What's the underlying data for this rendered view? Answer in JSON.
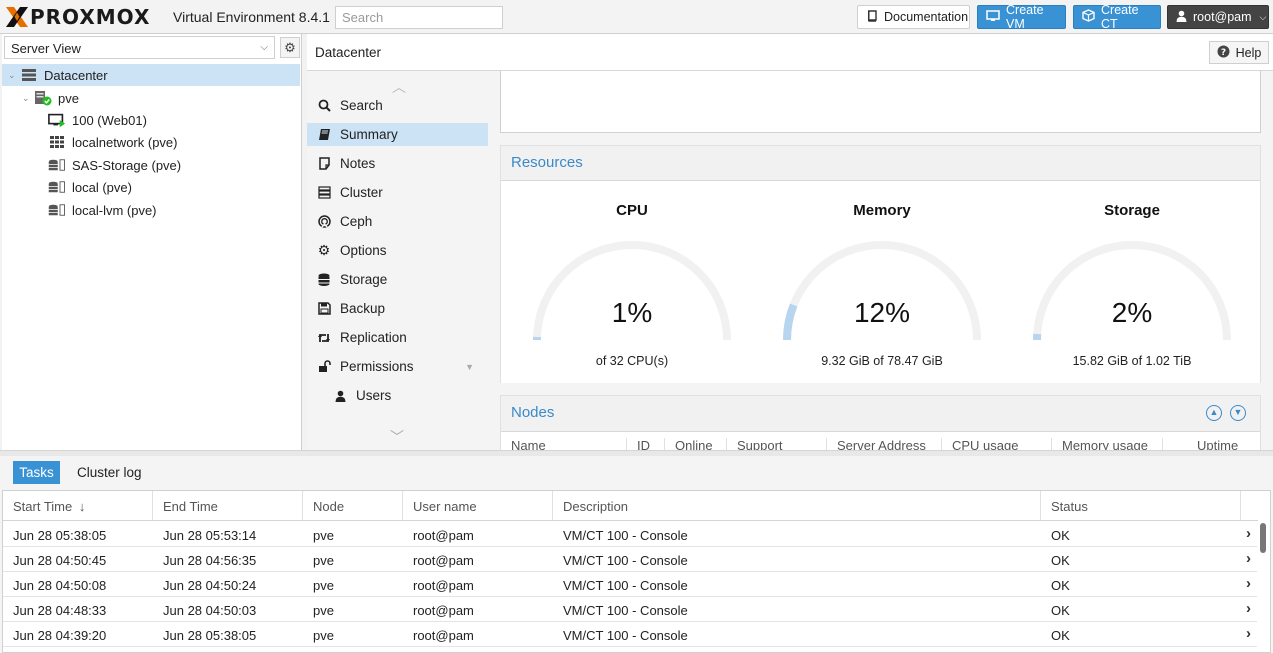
{
  "app": {
    "logo_text": "PROXMOX",
    "version": "Virtual Environment 8.4.1",
    "search_placeholder": "Search"
  },
  "toolbar": {
    "documentation": "Documentation",
    "create_vm": "Create VM",
    "create_ct": "Create CT",
    "user": "root@pam"
  },
  "tree": {
    "view": "Server View",
    "items": [
      {
        "label": "Datacenter"
      },
      {
        "label": "pve"
      },
      {
        "label": "100 (Web01)"
      },
      {
        "label": "localnetwork (pve)"
      },
      {
        "label": "SAS-Storage (pve)"
      },
      {
        "label": "local (pve)"
      },
      {
        "label": "local-lvm (pve)"
      }
    ]
  },
  "header": {
    "title": "Datacenter",
    "help": "Help"
  },
  "menu": {
    "items": [
      {
        "label": "Search",
        "icon": "search-icon"
      },
      {
        "label": "Summary",
        "icon": "book-icon"
      },
      {
        "label": "Notes",
        "icon": "notes-icon"
      },
      {
        "label": "Cluster",
        "icon": "server-icon"
      },
      {
        "label": "Ceph",
        "icon": "ceph-icon"
      },
      {
        "label": "Options",
        "icon": "gear-icon"
      },
      {
        "label": "Storage",
        "icon": "database-icon"
      },
      {
        "label": "Backup",
        "icon": "floppy-icon"
      },
      {
        "label": "Replication",
        "icon": "retweet-icon"
      },
      {
        "label": "Permissions",
        "icon": "unlock-icon"
      },
      {
        "label": "Users",
        "icon": "user-icon"
      }
    ]
  },
  "resources": {
    "title": "Resources",
    "gauges": [
      {
        "title": "CPU",
        "value": "1%",
        "fraction": 0.01,
        "sub": "of 32 CPU(s)"
      },
      {
        "title": "Memory",
        "value": "12%",
        "fraction": 0.12,
        "sub": "9.32 GiB of 78.47 GiB"
      },
      {
        "title": "Storage",
        "value": "2%",
        "fraction": 0.02,
        "sub": "15.82 GiB of 1.02 TiB"
      }
    ],
    "gauge_track_color": "#f1f1f1",
    "gauge_fill_color": "#b7d5ee"
  },
  "nodes": {
    "title": "Nodes",
    "columns": [
      "Name",
      "ID",
      "Online",
      "Support",
      "Server Address",
      "CPU usage",
      "Memory usage",
      "Uptime"
    ]
  },
  "tasks": {
    "tabs": [
      "Tasks",
      "Cluster log"
    ],
    "columns": [
      "Start Time",
      "End Time",
      "Node",
      "User name",
      "Description",
      "Status"
    ],
    "sort_indicator": "↓",
    "rows": [
      {
        "start": "Jun 28 05:38:05",
        "end": "Jun 28 05:53:14",
        "node": "pve",
        "user": "root@pam",
        "desc": "VM/CT 100 - Console",
        "status": "OK"
      },
      {
        "start": "Jun 28 04:50:45",
        "end": "Jun 28 04:56:35",
        "node": "pve",
        "user": "root@pam",
        "desc": "VM/CT 100 - Console",
        "status": "OK"
      },
      {
        "start": "Jun 28 04:50:08",
        "end": "Jun 28 04:50:24",
        "node": "pve",
        "user": "root@pam",
        "desc": "VM/CT 100 - Console",
        "status": "OK"
      },
      {
        "start": "Jun 28 04:48:33",
        "end": "Jun 28 04:50:03",
        "node": "pve",
        "user": "root@pam",
        "desc": "VM/CT 100 - Console",
        "status": "OK"
      },
      {
        "start": "Jun 28 04:39:20",
        "end": "Jun 28 05:38:05",
        "node": "pve",
        "user": "root@pam",
        "desc": "VM/CT 100 - Console",
        "status": "OK"
      }
    ]
  },
  "colors": {
    "accent": "#3892d4",
    "selection": "#cce3f6",
    "logo_orange": "#e57000",
    "running_green": "#21bf21"
  }
}
